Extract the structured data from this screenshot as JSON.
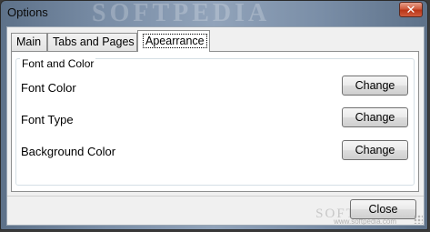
{
  "window": {
    "title": "Options",
    "watermark": "SOFTPEDIA",
    "close_glyph": "✕"
  },
  "tabs": [
    {
      "label": "Main",
      "active": false
    },
    {
      "label": "Tabs and Pages",
      "active": false
    },
    {
      "label": "Apearrance",
      "active": true
    }
  ],
  "group": {
    "title": "Font and Color",
    "rows": [
      {
        "label": "Font Color",
        "button": "Change"
      },
      {
        "label": "Font Type",
        "button": "Change"
      },
      {
        "label": "Background Color",
        "button": "Change"
      }
    ]
  },
  "footer": {
    "close_label": "Close",
    "watermark": "SOFTPEDIA",
    "url": "www.softpedia.com"
  },
  "colors": {
    "titlebar_accent": "#7a8ea7",
    "close_button": "#c74526"
  },
  "icons": [
    "close-icon",
    "resize-grip-icon"
  ]
}
